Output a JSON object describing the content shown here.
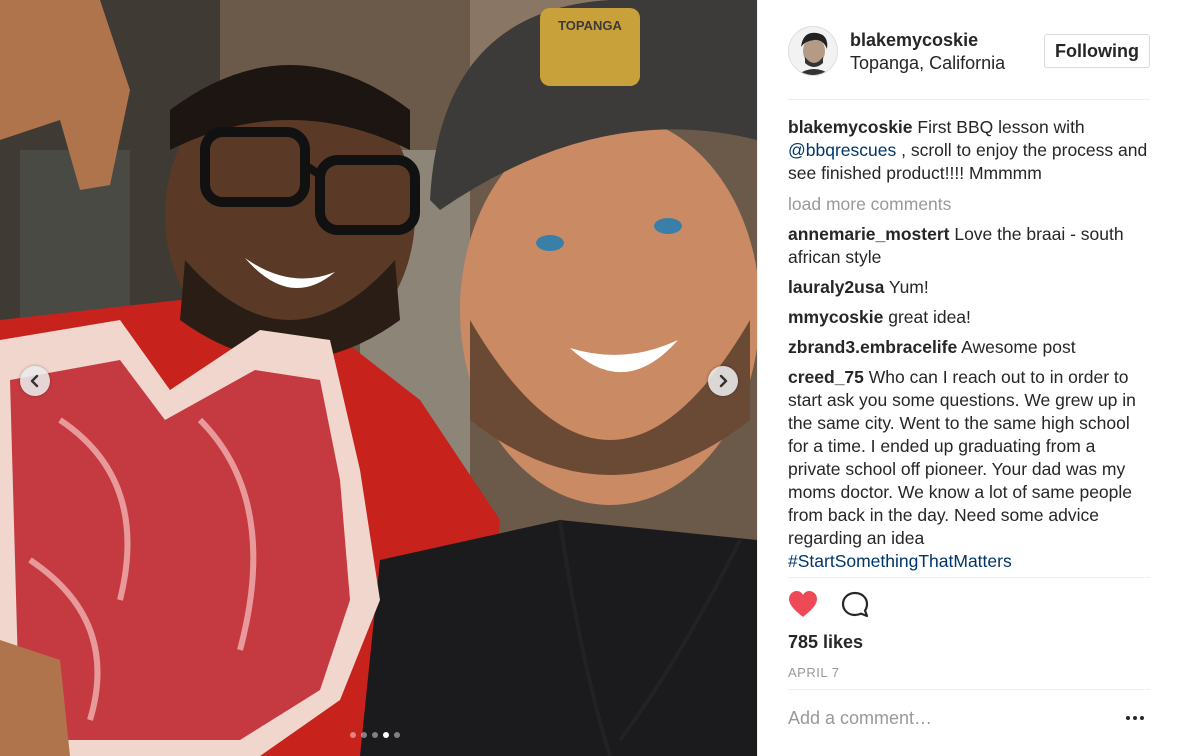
{
  "post": {
    "username": "blakemycoskie",
    "location": "Topanga, California",
    "follow_label": "Following",
    "caption": {
      "user": "blakemycoskie",
      "text_before": " First BBQ lesson with ",
      "mention": "@bbqrescues",
      "text_after": " , scroll to enjoy the process and see finished product!!!! Mmmmm"
    },
    "load_more_label": "load more comments",
    "comments": [
      {
        "user": "annemarie_mostert",
        "text": " Love the braai - south african style"
      },
      {
        "user": "lauraly2usa",
        "text": " Yum!"
      },
      {
        "user": "mmycoskie",
        "text": " great idea!"
      },
      {
        "user": "zbrand3.embracelife",
        "text": " Awesome post"
      },
      {
        "user": "creed_75",
        "text": " Who can I reach out to in order to start ask you some questions. We grew up in the same city. Went to the same high school for a time. I ended up graduating from a private school off pioneer. Your dad was my moms doctor. We know a lot of same people from back in the day. Need some advice regarding an idea ",
        "hashtag": "#StartSomethingThatMatters"
      }
    ],
    "likes": "785 likes",
    "date": "APRIL 7",
    "add_comment_placeholder": "Add a comment…",
    "cap_text": "TOPANGA",
    "carousel": {
      "count": 5,
      "active": 3
    }
  },
  "icons": {
    "heart": "heart-icon",
    "comment": "comment-bubble-icon",
    "prev": "chevron-left-icon",
    "next": "chevron-right-icon",
    "more": "ellipsis-icon"
  },
  "colors": {
    "heart": "#ed4956",
    "link": "#003569",
    "muted": "#999999"
  }
}
